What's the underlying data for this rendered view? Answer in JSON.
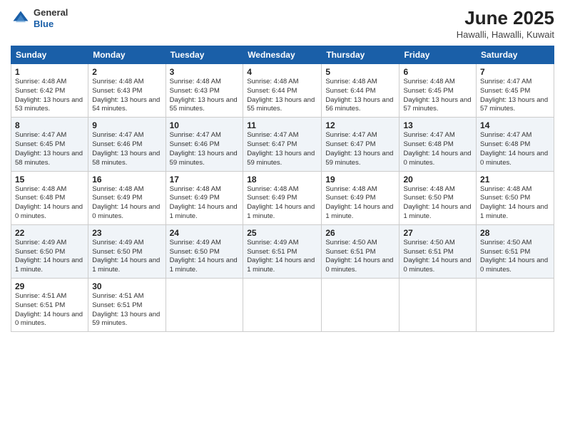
{
  "header": {
    "logo": {
      "general": "General",
      "blue": "Blue"
    },
    "title": "June 2025",
    "subtitle": "Hawalli, Hawalli, Kuwait"
  },
  "weekdays": [
    "Sunday",
    "Monday",
    "Tuesday",
    "Wednesday",
    "Thursday",
    "Friday",
    "Saturday"
  ],
  "weeks": [
    [
      {
        "day": "1",
        "sunrise": "Sunrise: 4:48 AM",
        "sunset": "Sunset: 6:42 PM",
        "daylight": "Daylight: 13 hours and 53 minutes."
      },
      {
        "day": "2",
        "sunrise": "Sunrise: 4:48 AM",
        "sunset": "Sunset: 6:43 PM",
        "daylight": "Daylight: 13 hours and 54 minutes."
      },
      {
        "day": "3",
        "sunrise": "Sunrise: 4:48 AM",
        "sunset": "Sunset: 6:43 PM",
        "daylight": "Daylight: 13 hours and 55 minutes."
      },
      {
        "day": "4",
        "sunrise": "Sunrise: 4:48 AM",
        "sunset": "Sunset: 6:44 PM",
        "daylight": "Daylight: 13 hours and 55 minutes."
      },
      {
        "day": "5",
        "sunrise": "Sunrise: 4:48 AM",
        "sunset": "Sunset: 6:44 PM",
        "daylight": "Daylight: 13 hours and 56 minutes."
      },
      {
        "day": "6",
        "sunrise": "Sunrise: 4:48 AM",
        "sunset": "Sunset: 6:45 PM",
        "daylight": "Daylight: 13 hours and 57 minutes."
      },
      {
        "day": "7",
        "sunrise": "Sunrise: 4:47 AM",
        "sunset": "Sunset: 6:45 PM",
        "daylight": "Daylight: 13 hours and 57 minutes."
      }
    ],
    [
      {
        "day": "8",
        "sunrise": "Sunrise: 4:47 AM",
        "sunset": "Sunset: 6:45 PM",
        "daylight": "Daylight: 13 hours and 58 minutes."
      },
      {
        "day": "9",
        "sunrise": "Sunrise: 4:47 AM",
        "sunset": "Sunset: 6:46 PM",
        "daylight": "Daylight: 13 hours and 58 minutes."
      },
      {
        "day": "10",
        "sunrise": "Sunrise: 4:47 AM",
        "sunset": "Sunset: 6:46 PM",
        "daylight": "Daylight: 13 hours and 59 minutes."
      },
      {
        "day": "11",
        "sunrise": "Sunrise: 4:47 AM",
        "sunset": "Sunset: 6:47 PM",
        "daylight": "Daylight: 13 hours and 59 minutes."
      },
      {
        "day": "12",
        "sunrise": "Sunrise: 4:47 AM",
        "sunset": "Sunset: 6:47 PM",
        "daylight": "Daylight: 13 hours and 59 minutes."
      },
      {
        "day": "13",
        "sunrise": "Sunrise: 4:47 AM",
        "sunset": "Sunset: 6:48 PM",
        "daylight": "Daylight: 14 hours and 0 minutes."
      },
      {
        "day": "14",
        "sunrise": "Sunrise: 4:47 AM",
        "sunset": "Sunset: 6:48 PM",
        "daylight": "Daylight: 14 hours and 0 minutes."
      }
    ],
    [
      {
        "day": "15",
        "sunrise": "Sunrise: 4:48 AM",
        "sunset": "Sunset: 6:48 PM",
        "daylight": "Daylight: 14 hours and 0 minutes."
      },
      {
        "day": "16",
        "sunrise": "Sunrise: 4:48 AM",
        "sunset": "Sunset: 6:49 PM",
        "daylight": "Daylight: 14 hours and 0 minutes."
      },
      {
        "day": "17",
        "sunrise": "Sunrise: 4:48 AM",
        "sunset": "Sunset: 6:49 PM",
        "daylight": "Daylight: 14 hours and 1 minute."
      },
      {
        "day": "18",
        "sunrise": "Sunrise: 4:48 AM",
        "sunset": "Sunset: 6:49 PM",
        "daylight": "Daylight: 14 hours and 1 minute."
      },
      {
        "day": "19",
        "sunrise": "Sunrise: 4:48 AM",
        "sunset": "Sunset: 6:49 PM",
        "daylight": "Daylight: 14 hours and 1 minute."
      },
      {
        "day": "20",
        "sunrise": "Sunrise: 4:48 AM",
        "sunset": "Sunset: 6:50 PM",
        "daylight": "Daylight: 14 hours and 1 minute."
      },
      {
        "day": "21",
        "sunrise": "Sunrise: 4:48 AM",
        "sunset": "Sunset: 6:50 PM",
        "daylight": "Daylight: 14 hours and 1 minute."
      }
    ],
    [
      {
        "day": "22",
        "sunrise": "Sunrise: 4:49 AM",
        "sunset": "Sunset: 6:50 PM",
        "daylight": "Daylight: 14 hours and 1 minute."
      },
      {
        "day": "23",
        "sunrise": "Sunrise: 4:49 AM",
        "sunset": "Sunset: 6:50 PM",
        "daylight": "Daylight: 14 hours and 1 minute."
      },
      {
        "day": "24",
        "sunrise": "Sunrise: 4:49 AM",
        "sunset": "Sunset: 6:50 PM",
        "daylight": "Daylight: 14 hours and 1 minute."
      },
      {
        "day": "25",
        "sunrise": "Sunrise: 4:49 AM",
        "sunset": "Sunset: 6:51 PM",
        "daylight": "Daylight: 14 hours and 1 minute."
      },
      {
        "day": "26",
        "sunrise": "Sunrise: 4:50 AM",
        "sunset": "Sunset: 6:51 PM",
        "daylight": "Daylight: 14 hours and 0 minutes."
      },
      {
        "day": "27",
        "sunrise": "Sunrise: 4:50 AM",
        "sunset": "Sunset: 6:51 PM",
        "daylight": "Daylight: 14 hours and 0 minutes."
      },
      {
        "day": "28",
        "sunrise": "Sunrise: 4:50 AM",
        "sunset": "Sunset: 6:51 PM",
        "daylight": "Daylight: 14 hours and 0 minutes."
      }
    ],
    [
      {
        "day": "29",
        "sunrise": "Sunrise: 4:51 AM",
        "sunset": "Sunset: 6:51 PM",
        "daylight": "Daylight: 14 hours and 0 minutes."
      },
      {
        "day": "30",
        "sunrise": "Sunrise: 4:51 AM",
        "sunset": "Sunset: 6:51 PM",
        "daylight": "Daylight: 13 hours and 59 minutes."
      },
      null,
      null,
      null,
      null,
      null
    ]
  ]
}
